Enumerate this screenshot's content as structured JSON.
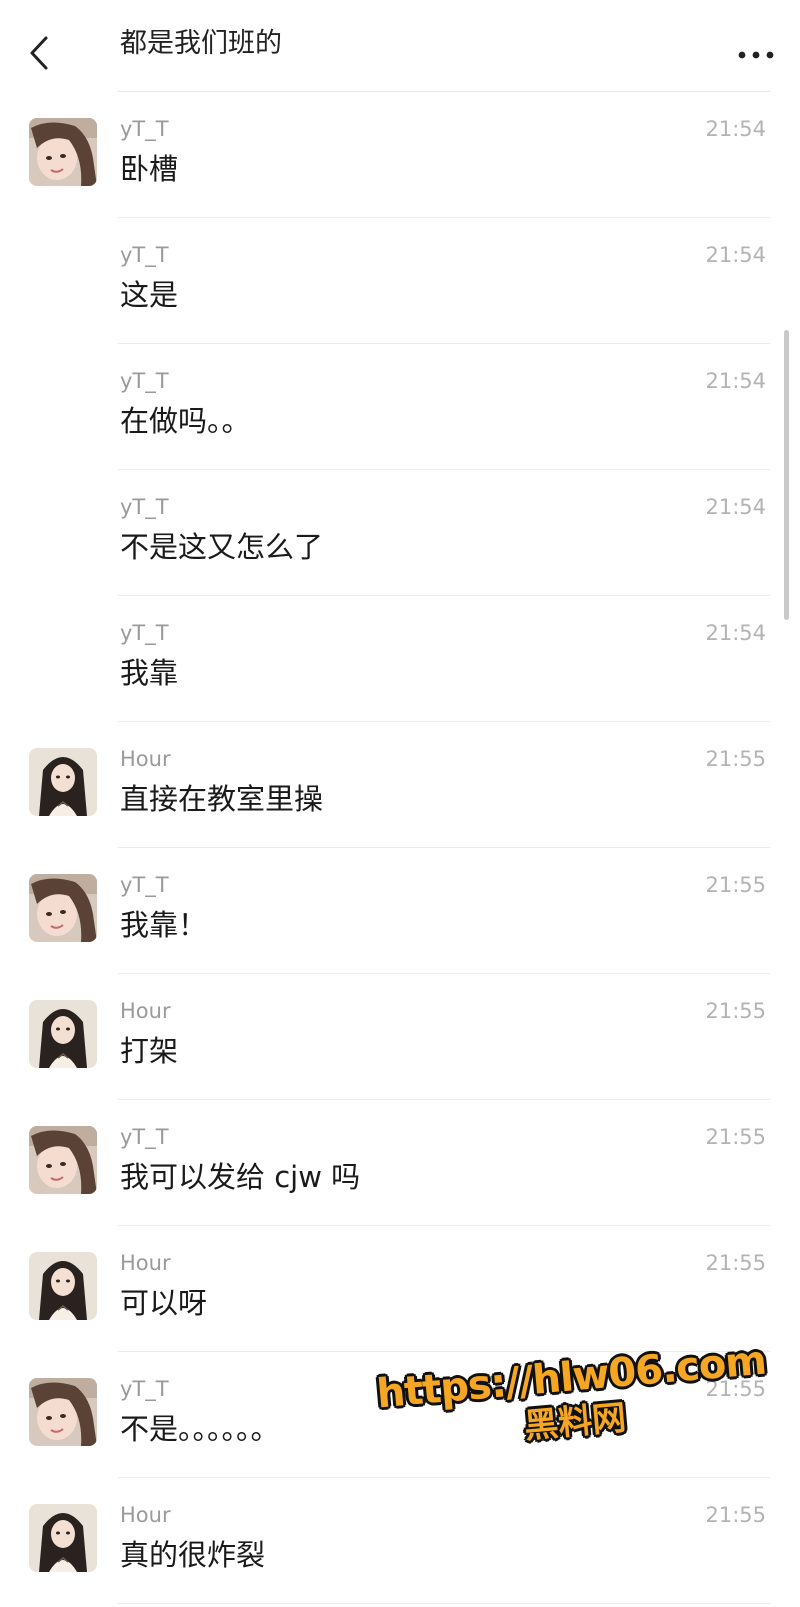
{
  "header": {
    "back_icon": "chevron-left-icon",
    "title": "都是我们班的",
    "more_icon": "more-horizontal-icon"
  },
  "messages": [
    {
      "sender": "yT_T",
      "time": "21:54",
      "text": "卧槽",
      "avatar": true,
      "avatar_user": "yT_T"
    },
    {
      "sender": "yT_T",
      "time": "21:54",
      "text": "这是",
      "avatar": false
    },
    {
      "sender": "yT_T",
      "time": "21:54",
      "text": "在做吗。。",
      "avatar": false
    },
    {
      "sender": "yT_T",
      "time": "21:54",
      "text": "不是这又怎么了",
      "avatar": false
    },
    {
      "sender": "yT_T",
      "time": "21:54",
      "text": "我靠",
      "avatar": false
    },
    {
      "sender": "Hour",
      "time": "21:55",
      "text": "直接在教室里操",
      "avatar": true,
      "avatar_user": "Hour"
    },
    {
      "sender": "yT_T",
      "time": "21:55",
      "text": "我靠！",
      "avatar": true,
      "avatar_user": "yT_T"
    },
    {
      "sender": "Hour",
      "time": "21:55",
      "text": "打架",
      "avatar": true,
      "avatar_user": "Hour"
    },
    {
      "sender": "yT_T",
      "time": "21:55",
      "text": "我可以发给 cjw 吗",
      "avatar": true,
      "avatar_user": "yT_T"
    },
    {
      "sender": "Hour",
      "time": "21:55",
      "text": "可以呀",
      "avatar": true,
      "avatar_user": "Hour"
    },
    {
      "sender": "yT_T",
      "time": "21:55",
      "text": "不是。。。。。。",
      "avatar": true,
      "avatar_user": "yT_T"
    },
    {
      "sender": "Hour",
      "time": "21:55",
      "text": "真的很炸裂",
      "avatar": true,
      "avatar_user": "Hour"
    }
  ],
  "watermark": {
    "url": "https://hlw06.com",
    "site": "黑料网",
    "color": "#f5a623"
  },
  "colors": {
    "sender": "#9a9a9a",
    "time": "#b3b3b3",
    "divider": "#ececec"
  }
}
